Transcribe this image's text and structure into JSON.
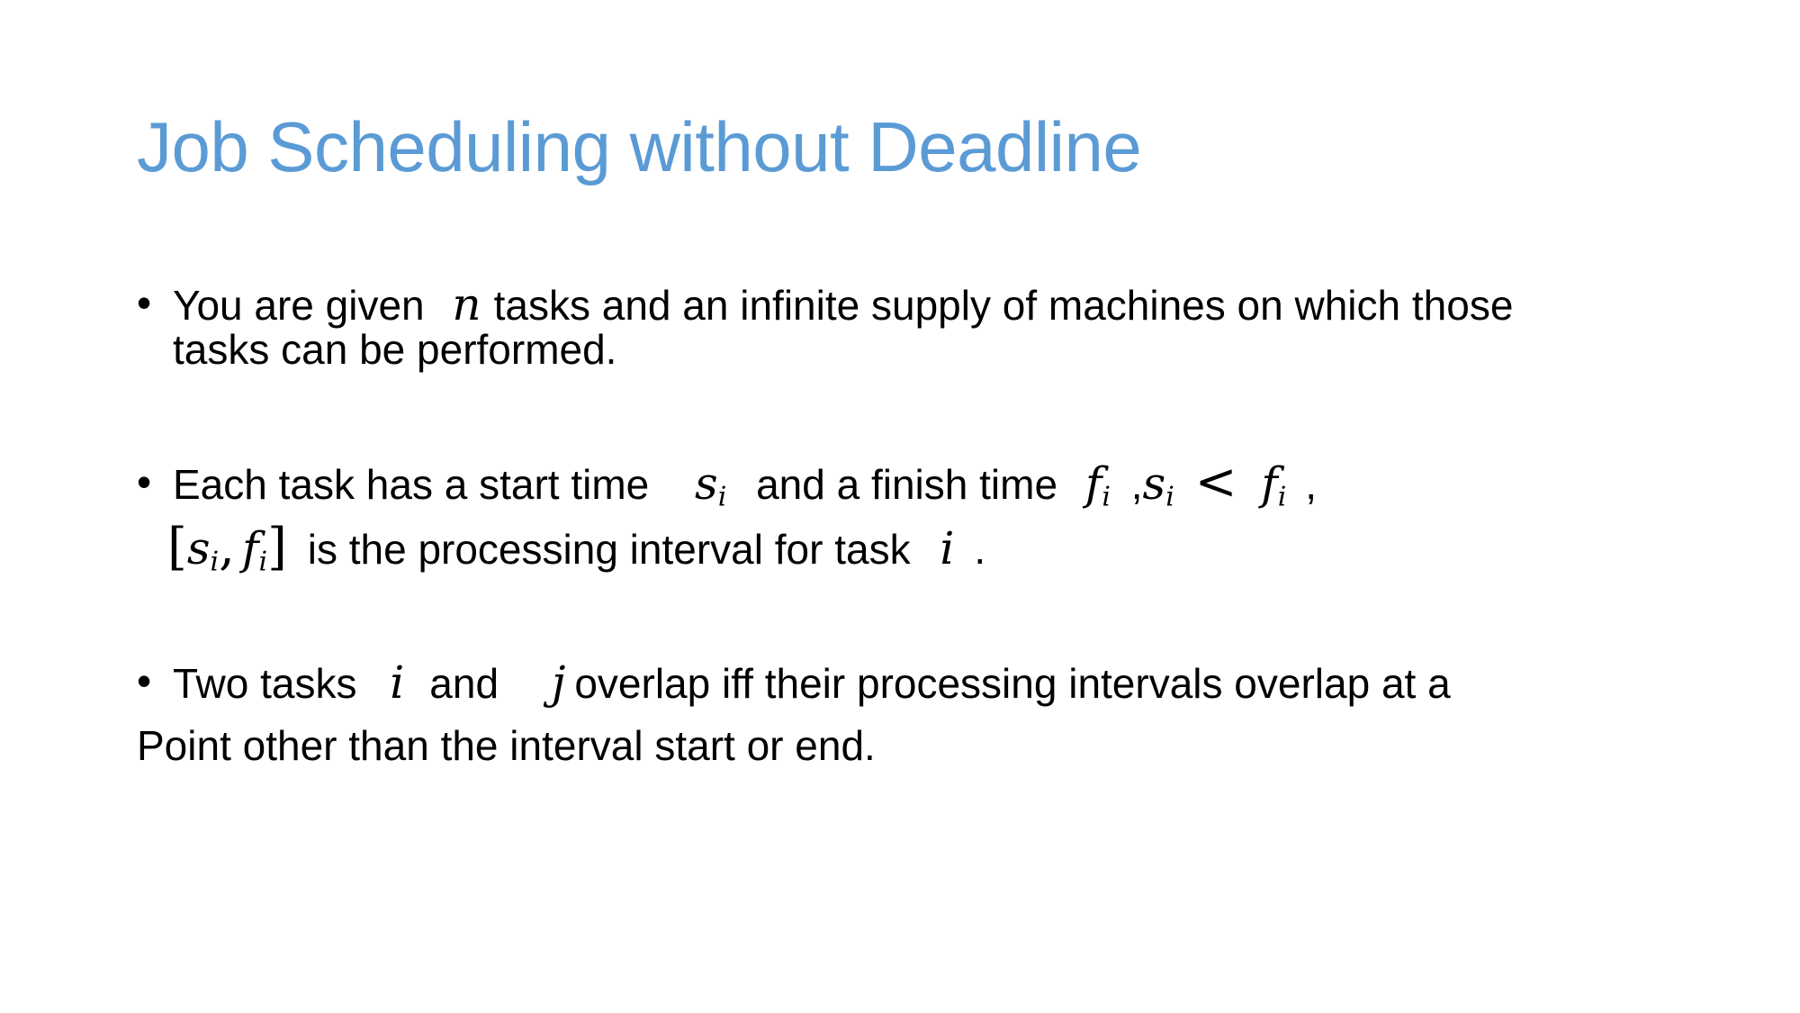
{
  "slide": {
    "title": "Job Scheduling without Deadline",
    "title_color": "#5B9BD5",
    "bullet_char": "•",
    "bullet1": {
      "part1": "You are given",
      "var_n": "n",
      "part2": "tasks and an infinite supply of machines on which those",
      "line2": "tasks can be performed."
    },
    "bullet2": {
      "part1": "Each task has a start time",
      "s": "s",
      "sub_i": "i",
      "part2": "and a finish time",
      "f": "f",
      "comma": ",",
      "lt": "<",
      "trailing_comma": ",",
      "lbracket": "[",
      "rbracket": "]",
      "sep": ",",
      "line2_text": "is the processing interval for task",
      "var_i": "i",
      "period": "."
    },
    "bullet3": {
      "part1": "Two tasks",
      "var_i": "i",
      "and": "and",
      "var_j": "j",
      "part2": "overlap iff their processing intervals overlap at a",
      "line2": "Point other than the interval start or end."
    }
  }
}
